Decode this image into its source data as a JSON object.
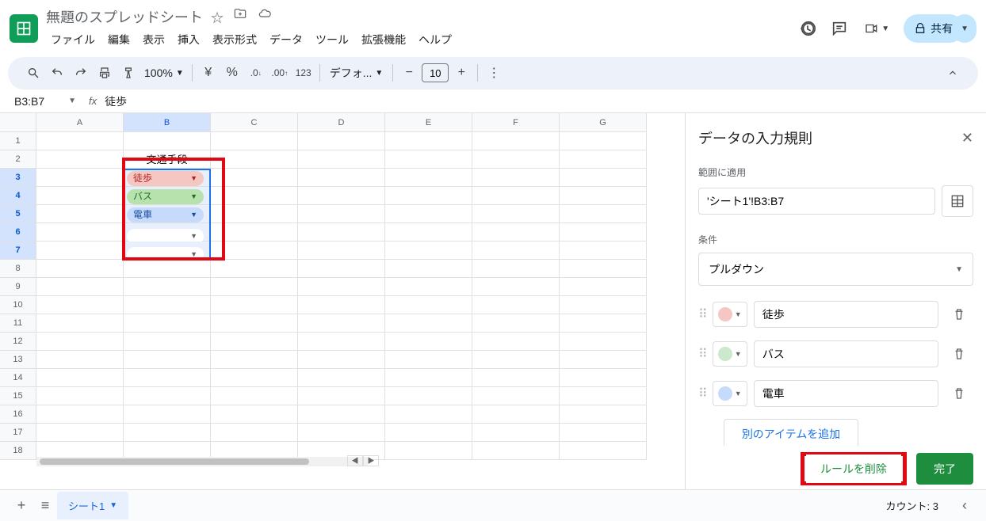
{
  "doc": {
    "title": "無題のスプレッドシート"
  },
  "menus": [
    "ファイル",
    "編集",
    "表示",
    "挿入",
    "表示形式",
    "データ",
    "ツール",
    "拡張機能",
    "ヘルプ"
  ],
  "share": {
    "label": "共有"
  },
  "toolbar": {
    "zoom": "100%",
    "font": "デフォ...",
    "size": "10"
  },
  "namebox": "B3:B7",
  "formula": "徒歩",
  "columns": [
    "A",
    "B",
    "C",
    "D",
    "E",
    "F",
    "G"
  ],
  "rows": [
    1,
    2,
    3,
    4,
    5,
    6,
    7,
    8,
    9,
    10,
    11,
    12,
    13,
    14,
    15,
    16,
    17,
    18
  ],
  "b2": "交通手段",
  "chips": {
    "b3": "徒歩",
    "b4": "バス",
    "b5": "電車"
  },
  "panel": {
    "title": "データの入力規則",
    "range_label": "範囲に適用",
    "range": "'シート1'!B3:B7",
    "criteria_label": "条件",
    "criteria": "プルダウン",
    "options": [
      {
        "color": "dot-red",
        "value": "徒歩"
      },
      {
        "color": "dot-green",
        "value": "バス"
      },
      {
        "color": "dot-blue",
        "value": "電車"
      }
    ],
    "add_item": "別のアイテムを追加",
    "delete_rule": "ルールを削除",
    "done": "完了"
  },
  "footer": {
    "sheet": "シート1",
    "count": "カウント: 3"
  }
}
